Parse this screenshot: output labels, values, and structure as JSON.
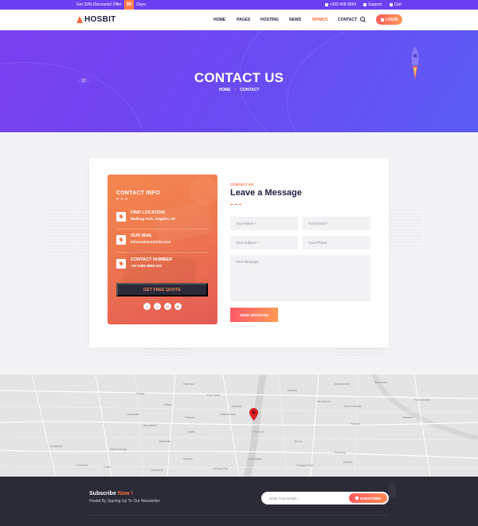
{
  "topbar": {
    "offer_text": "Get 30% Discounts! Offer",
    "days_count": "00",
    "days_label": "Days",
    "phone": "+303 458 9564",
    "support": "Support",
    "cart": "Cart"
  },
  "nav": {
    "logo": "HOSBIT",
    "items": [
      "HOME",
      "PAGES",
      "HOSTING",
      "NEWS",
      "WHMCS",
      "CONTACT"
    ],
    "active_item": "WHMCS",
    "login": "LOGIN"
  },
  "hero": {
    "title": "CONTACT US",
    "crumb_home": "HOME",
    "crumb_sep": "•",
    "crumb_current": "CONTACT"
  },
  "contact_info": {
    "title": "CONTACT INFO",
    "items": [
      {
        "label": "FIND LOCATION",
        "value": "Walking Park, Angeles, WI",
        "icon": "map-pin-icon"
      },
      {
        "label": "OUR MAIL",
        "value": "informations@info.com",
        "icon": "mail-icon"
      },
      {
        "label": "CONTACT NUMBER",
        "value": "+92 5456 8898 523",
        "icon": "phone-icon"
      }
    ],
    "quote_button": "GET FREE QUOTE",
    "socials": [
      "f",
      "t",
      "in",
      "▶"
    ]
  },
  "form": {
    "kicker": "CONTACT US",
    "title": "Leave a Message",
    "name_placeholder": "Your Name *",
    "email_placeholder": "Your Email *",
    "subject_placeholder": "Your Subject *",
    "phone_placeholder": "Your Phone",
    "message_placeholder": "Your Message",
    "send_button": "SEND MESSAGE"
  },
  "map": {
    "labels": [
      "Paterson",
      "Clifton",
      "Passaic",
      "Hackensack",
      "Yonkers",
      "Mt Vernon",
      "New Rochelle",
      "Teaneck",
      "Fort Lee",
      "Montclair",
      "Bloomfield",
      "Belleville",
      "Nutley",
      "Newark",
      "West Orange",
      "Livingston",
      "Union",
      "Elizabeth",
      "Jersey City",
      "Bronx",
      "Manhattan",
      "Queens",
      "Flushing",
      "Cranford",
      "Eastchester",
      "Scarsdale",
      "Port Chester",
      "Pelham",
      "College Point",
      "Harrison",
      "Totowa",
      "Fair Lawn"
    ],
    "colors": {
      "land": "#e4e4e4",
      "road": "#ffffff",
      "water": "#d4d4d4",
      "pin": "#d81f26"
    }
  },
  "footer": {
    "subscribe_title": "Subscribe",
    "subscribe_now": "Now !",
    "subscribe_text": "Hosbit By Signing Up To Our Newsletter.",
    "email_placeholder": "Enter Your Email...",
    "subscribe_button": "SUBSCRIBE"
  },
  "colors": {
    "brand_purple": "#6c3ff0",
    "accent_orange": "#ff6a3d",
    "dark": "#1c1f3f",
    "footer_bg": "#2b2b38"
  }
}
